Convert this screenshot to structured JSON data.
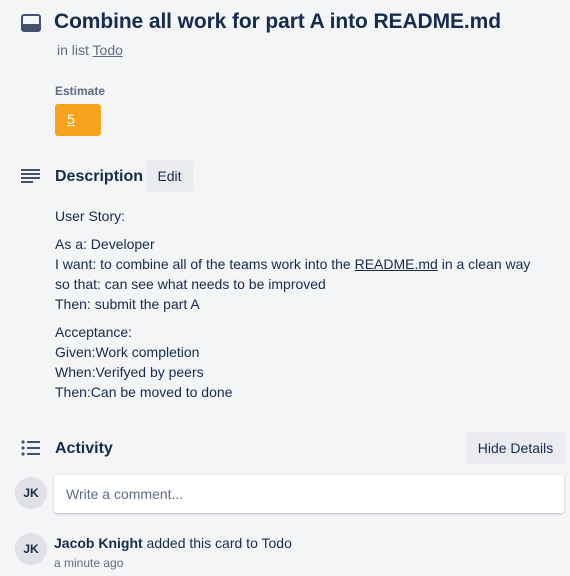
{
  "card": {
    "title": "Combine all work for part A into README.md",
    "in_list_prefix": "in list",
    "list_name": "Todo",
    "header_icon": "card-icon"
  },
  "estimate": {
    "label": "Estimate",
    "value": "5",
    "color": "#f6a21a"
  },
  "description": {
    "title": "Description",
    "edit_label": "Edit",
    "icon": "description-icon",
    "lines": {
      "user_story": "User Story:",
      "as_a": "As a: Developer",
      "i_want_prefix": "I want: to combine all of the teams work into the ",
      "i_want_link": "README.md",
      "i_want_suffix": " in a clean way",
      "so_that": "so that: can see what needs to be improved",
      "then": "Then: submit the part A",
      "acceptance": "Acceptance:",
      "given": "Given:Work completion",
      "when": "When:Verifyed by peers",
      "then_done": "Then:Can be moved to done"
    }
  },
  "activity": {
    "title": "Activity",
    "icon": "activity-icon",
    "hide_details_label": "Hide Details",
    "comment_placeholder": "Write a comment...",
    "current_user_initials": "JK",
    "entries": [
      {
        "initials": "JK",
        "user": "Jacob Knight",
        "action": " added this card to Todo",
        "time": "a minute ago"
      }
    ]
  }
}
